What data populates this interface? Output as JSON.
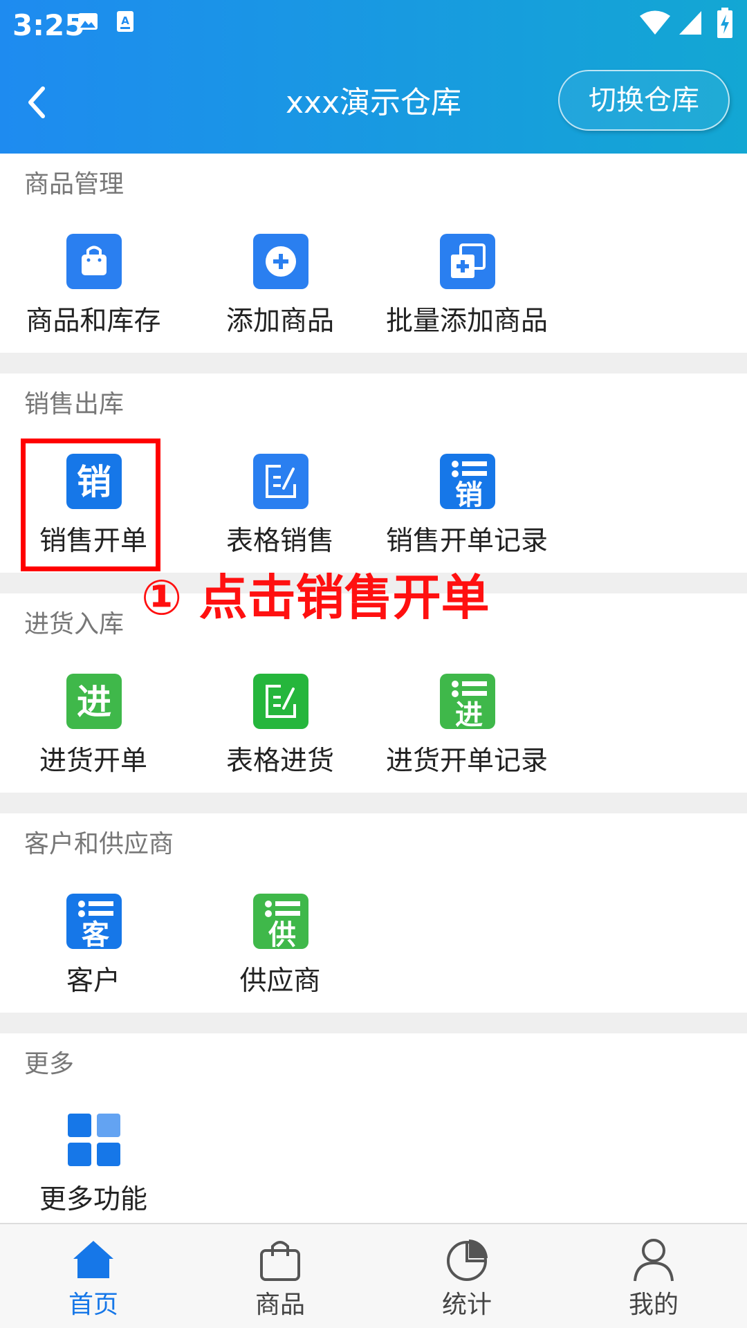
{
  "status_bar": {
    "time": "3:25"
  },
  "header": {
    "title": "xxx演示仓库",
    "switch_button": "切换仓库"
  },
  "sections": [
    {
      "title": "商品管理",
      "items": [
        {
          "label": "商品和库存",
          "icon": "shopping-bag-icon",
          "color": "#2a7ff0"
        },
        {
          "label": "添加商品",
          "icon": "plus-circle-icon",
          "color": "#2a7ff0"
        },
        {
          "label": "批量添加商品",
          "icon": "batch-add-icon",
          "color": "#2a7ff0"
        }
      ]
    },
    {
      "title": "销售出库",
      "items": [
        {
          "label": "销售开单",
          "icon": "sales-order-icon",
          "glyph": "销",
          "color": "#1677e8"
        },
        {
          "label": "表格销售",
          "icon": "edit-form-icon",
          "color": "#2a7ff0"
        },
        {
          "label": "销售开单记录",
          "icon": "sales-record-icon",
          "glyph": "销",
          "color": "#1677e8"
        }
      ]
    },
    {
      "title": "进货入库",
      "items": [
        {
          "label": "进货开单",
          "icon": "purchase-order-icon",
          "glyph": "进",
          "color": "#3fb84a"
        },
        {
          "label": "表格进货",
          "icon": "edit-form-icon",
          "color": "#25b63c"
        },
        {
          "label": "进货开单记录",
          "icon": "purchase-record-icon",
          "glyph": "进",
          "color": "#3fb84a"
        }
      ]
    },
    {
      "title": "客户和供应商",
      "items": [
        {
          "label": "客户",
          "icon": "customer-list-icon",
          "glyph": "客",
          "color": "#1677e8"
        },
        {
          "label": "供应商",
          "icon": "supplier-list-icon",
          "glyph": "供",
          "color": "#3fb84a"
        }
      ]
    },
    {
      "title": "更多",
      "items": [
        {
          "label": "更多功能",
          "icon": "grid-icon",
          "color": "#1677e8"
        }
      ]
    }
  ],
  "annotation": {
    "text": "① 点击销售开单",
    "color": "#ff1010"
  },
  "bottom_nav": [
    {
      "label": "首页",
      "icon": "home-icon",
      "active": true
    },
    {
      "label": "商品",
      "icon": "shopping-bag-icon",
      "active": false
    },
    {
      "label": "统计",
      "icon": "pie-chart-icon",
      "active": false
    },
    {
      "label": "我的",
      "icon": "person-icon",
      "active": false
    }
  ],
  "colors": {
    "header_start": "#1e8bf0",
    "header_end": "#13a7d3",
    "active": "#1677e8",
    "highlight": "#ff0000"
  }
}
